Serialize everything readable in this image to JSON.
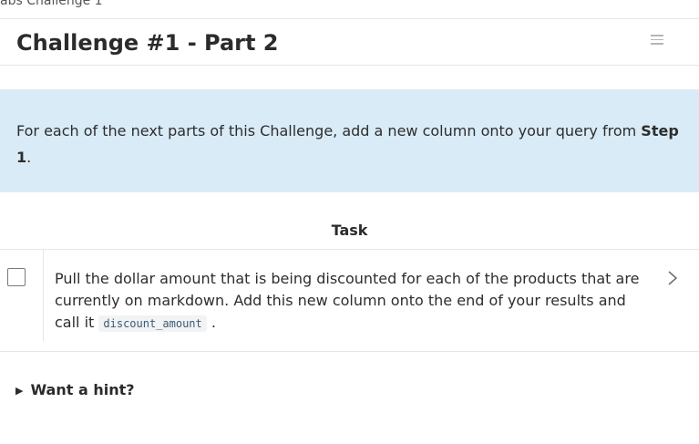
{
  "breadcrumb": "abs Challenge 1",
  "header": {
    "title": "Challenge #1 - Part 2"
  },
  "callout": {
    "text_before": "For each of the next parts of this Challenge, add a new column onto your query from ",
    "bold": "Step 1",
    "text_after": "."
  },
  "task": {
    "header": "Task",
    "text_before": "Pull the dollar amount that is being discounted for each of the products that are currently on markdown. Add this new column onto the end of your results and call it ",
    "code": "discount_amount",
    "text_after": " .",
    "checked": false
  },
  "hint": {
    "arrow": "▶",
    "label": "Want a hint?"
  },
  "colors": {
    "callout_bg": "#d9ebf7",
    "border": "#e6e6e6",
    "code_bg": "#f1f3f4"
  }
}
